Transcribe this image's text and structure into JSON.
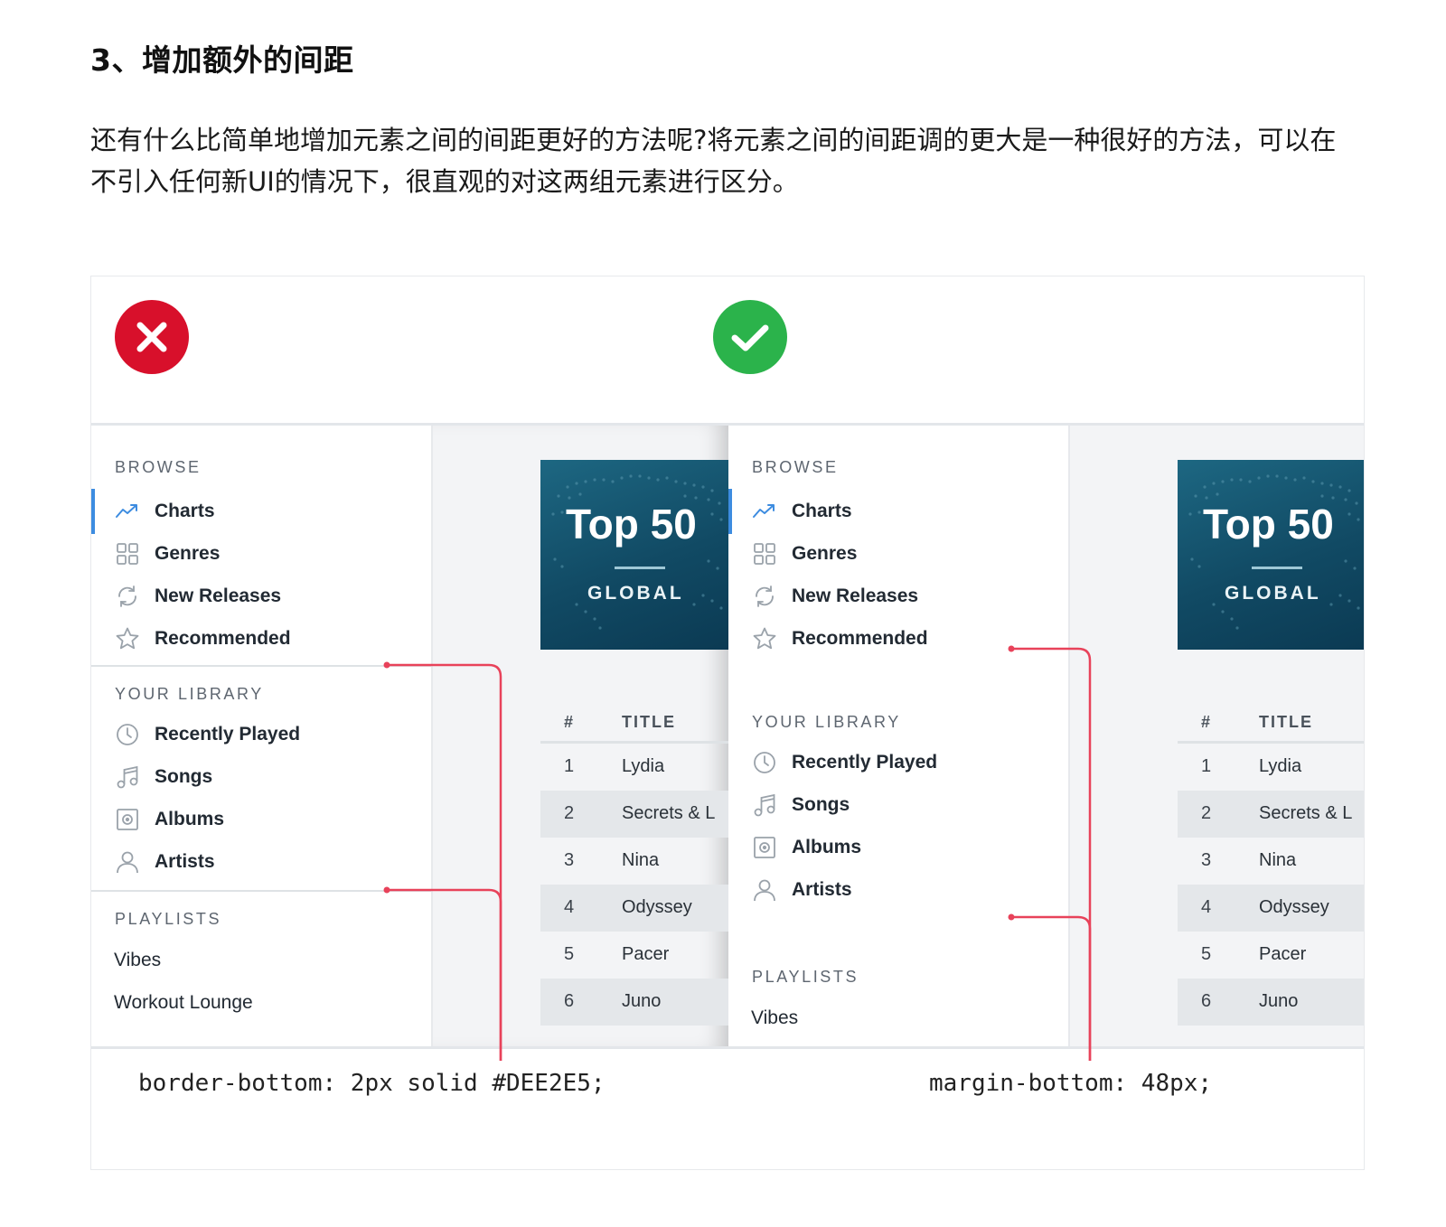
{
  "article": {
    "heading": "3、增加额外的间距",
    "paragraph": "还有什么比简单地增加元素之间的间距更好的方法呢?将元素之间的间距调的更大是一种很好的方法，可以在不引入任何新UI的情况下，很直观的对这两组元素进行区分。"
  },
  "figure": {
    "bad_icon": "x-icon",
    "good_icon": "check-icon",
    "colors": {
      "bad": "#d8102b",
      "good": "#2bb34b",
      "annotation": "#e8425a",
      "active_nav": "#3d8ce0",
      "album": "#114a64"
    },
    "sections": {
      "browse": "BROWSE",
      "library": "YOUR LIBRARY",
      "playlists": "PLAYLISTS"
    },
    "browse_items": [
      {
        "label": "Charts",
        "icon": "trending-icon"
      },
      {
        "label": "Genres",
        "icon": "grid-icon"
      },
      {
        "label": "New Releases",
        "icon": "refresh-icon"
      },
      {
        "label": "Recommended",
        "icon": "star-icon"
      }
    ],
    "library_items": [
      {
        "label": "Recently Played",
        "icon": "clock-icon"
      },
      {
        "label": "Songs",
        "icon": "music-note-icon"
      },
      {
        "label": "Albums",
        "icon": "album-icon"
      },
      {
        "label": "Artists",
        "icon": "user-icon"
      }
    ],
    "playlists": [
      "Vibes",
      "Workout Lounge"
    ],
    "album": {
      "title": "Top 50",
      "subtitle": "GLOBAL"
    },
    "table": {
      "col_num": "#",
      "col_title": "TITLE",
      "rows": [
        {
          "num": "1",
          "title": "Lydia"
        },
        {
          "num": "2",
          "title": "Secrets & L"
        },
        {
          "num": "3",
          "title": "Nina"
        },
        {
          "num": "4",
          "title": "Odyssey"
        },
        {
          "num": "5",
          "title": "Pacer"
        },
        {
          "num": "6",
          "title": "Juno"
        }
      ]
    },
    "code_left": "border-bottom: 2px solid #DEE2E5;",
    "code_right": "margin-bottom: 48px;"
  }
}
